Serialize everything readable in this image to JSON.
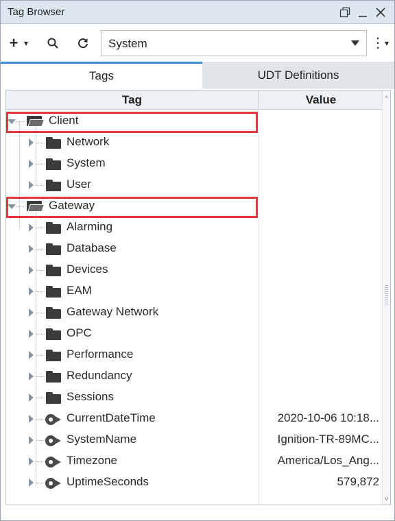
{
  "window": {
    "title": "Tag Browser"
  },
  "toolbar": {
    "add_icon": "+",
    "add_caret": "▾",
    "search_icon": "⚲",
    "refresh_icon": "↻",
    "provider_value": "System",
    "more_icon": "⋮",
    "more_caret": "▾"
  },
  "tabs": [
    {
      "label": "Tags",
      "active": true
    },
    {
      "label": "UDT Definitions",
      "active": false
    }
  ],
  "table": {
    "columns": [
      "Tag",
      "Value"
    ],
    "rows": [
      {
        "label": "Client",
        "kind": "folder-open",
        "value": ""
      },
      {
        "label": "Network",
        "kind": "folder",
        "value": ""
      },
      {
        "label": "System",
        "kind": "folder",
        "value": ""
      },
      {
        "label": "User",
        "kind": "folder",
        "value": ""
      },
      {
        "label": "Gateway",
        "kind": "folder-open",
        "value": ""
      },
      {
        "label": "Alarming",
        "kind": "folder",
        "value": ""
      },
      {
        "label": "Database",
        "kind": "folder",
        "value": ""
      },
      {
        "label": "Devices",
        "kind": "folder",
        "value": ""
      },
      {
        "label": "EAM",
        "kind": "folder",
        "value": ""
      },
      {
        "label": "Gateway Network",
        "kind": "folder",
        "value": ""
      },
      {
        "label": "OPC",
        "kind": "folder",
        "value": ""
      },
      {
        "label": "Performance",
        "kind": "folder",
        "value": ""
      },
      {
        "label": "Redundancy",
        "kind": "folder",
        "value": ""
      },
      {
        "label": "Sessions",
        "kind": "folder",
        "value": ""
      },
      {
        "label": "CurrentDateTime",
        "kind": "tag",
        "value": "2020-10-06 10:18..."
      },
      {
        "label": "SystemName",
        "kind": "tag",
        "value": "Ignition-TR-89MC..."
      },
      {
        "label": "Timezone",
        "kind": "tag",
        "value": "America/Los_Ang..."
      },
      {
        "label": "UptimeSeconds",
        "kind": "tag",
        "value": "579,872"
      }
    ]
  },
  "colors": {
    "highlight": "#e5373f",
    "active_tab_accent": "#3a8fd6",
    "titlebar": "#dde6ef"
  }
}
